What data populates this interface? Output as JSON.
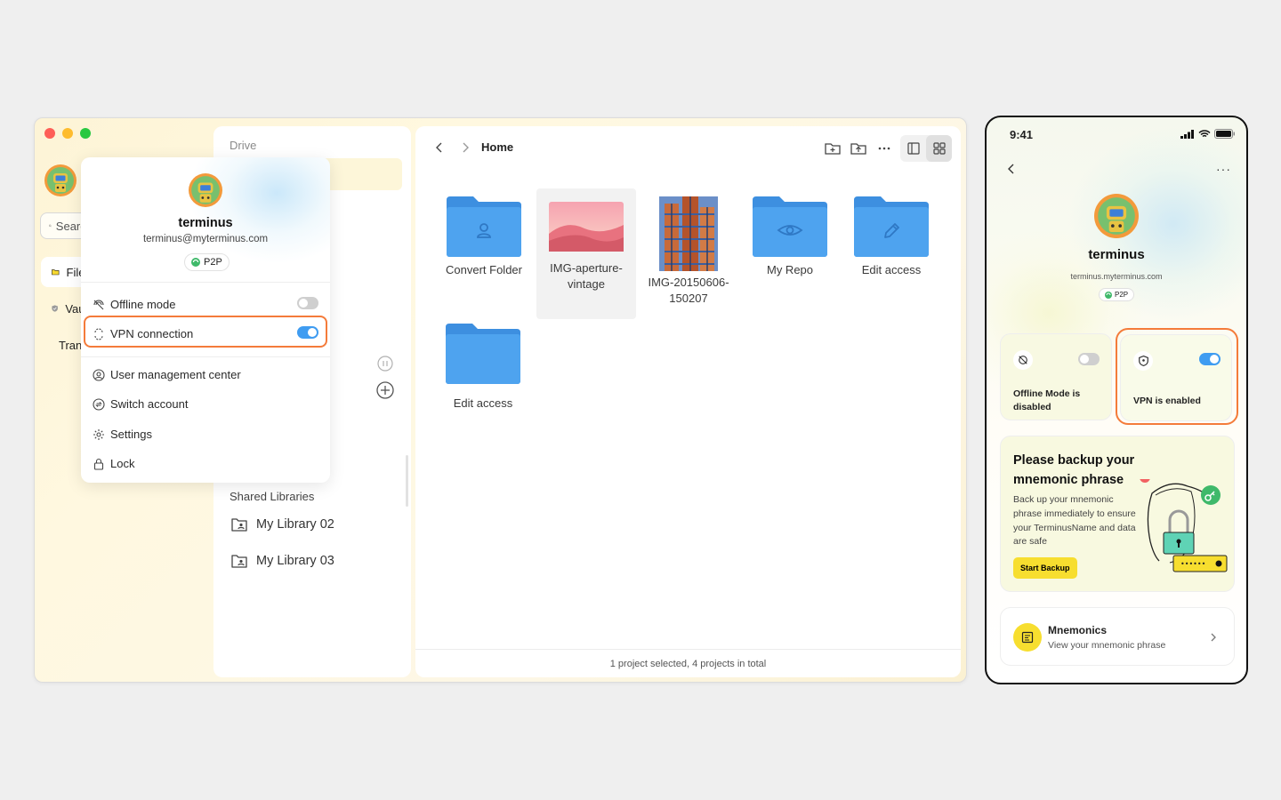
{
  "desktop": {
    "sidebar": {
      "search_placeholder": "Search",
      "nav_items": [
        {
          "label": "Files",
          "icon": "folder-icon"
        },
        {
          "label": "Vault",
          "icon": "shield-icon"
        },
        {
          "label": "Transfer",
          "icon": "upload-icon"
        }
      ]
    },
    "middle": {
      "section_title": "Drive",
      "shared_title": "Shared Libraries",
      "libraries": [
        "My Library 02",
        "My Library 03"
      ]
    },
    "content": {
      "breadcrumb": "Home",
      "items": [
        {
          "name": "Convert Folder",
          "kind": "folder",
          "badge": "person-icon",
          "selected": false
        },
        {
          "name": "IMG-aperture-vintage",
          "kind": "image",
          "selected": true
        },
        {
          "name": "IMG-20150606-150207",
          "kind": "image",
          "selected": false
        },
        {
          "name": "My Repo",
          "kind": "folder",
          "badge": "eye-icon",
          "selected": false
        },
        {
          "name": "Edit access",
          "kind": "folder",
          "badge": "pencil-icon",
          "selected": false
        },
        {
          "name": "Edit access",
          "kind": "folder",
          "badge": "",
          "selected": false
        }
      ],
      "status": "1 project selected, 4 projects in total"
    },
    "menu": {
      "name": "terminus",
      "email": "terminus@myterminus.com",
      "badge": "P2P",
      "offline_label": "Offline mode",
      "offline_on": false,
      "vpn_label": "VPN connection",
      "vpn_on": true,
      "items": [
        "User management center",
        "Switch account",
        "Settings",
        "Lock"
      ]
    }
  },
  "phone": {
    "time": "9:41",
    "name": "terminus",
    "email": "terminus.myterminus.com",
    "badge": "P2P",
    "offline_card": "Offline Mode is disabled",
    "vpn_card": "VPN is enabled",
    "backup": {
      "title": "Please backup your mnemonic phrase",
      "text": "Back up your mnemonic phrase immediately to ensure your TerminusName and data are safe",
      "button": "Start Backup",
      "mask": "••••••"
    },
    "mnemonics": {
      "title": "Mnemonics",
      "subtitle": "View your mnemonic phrase"
    }
  },
  "colors": {
    "accent_blue": "#3f9cf1",
    "folder_blue": "#4ea3ef",
    "highlight_orange": "#f47b3a",
    "yellow": "#f7de2f"
  }
}
